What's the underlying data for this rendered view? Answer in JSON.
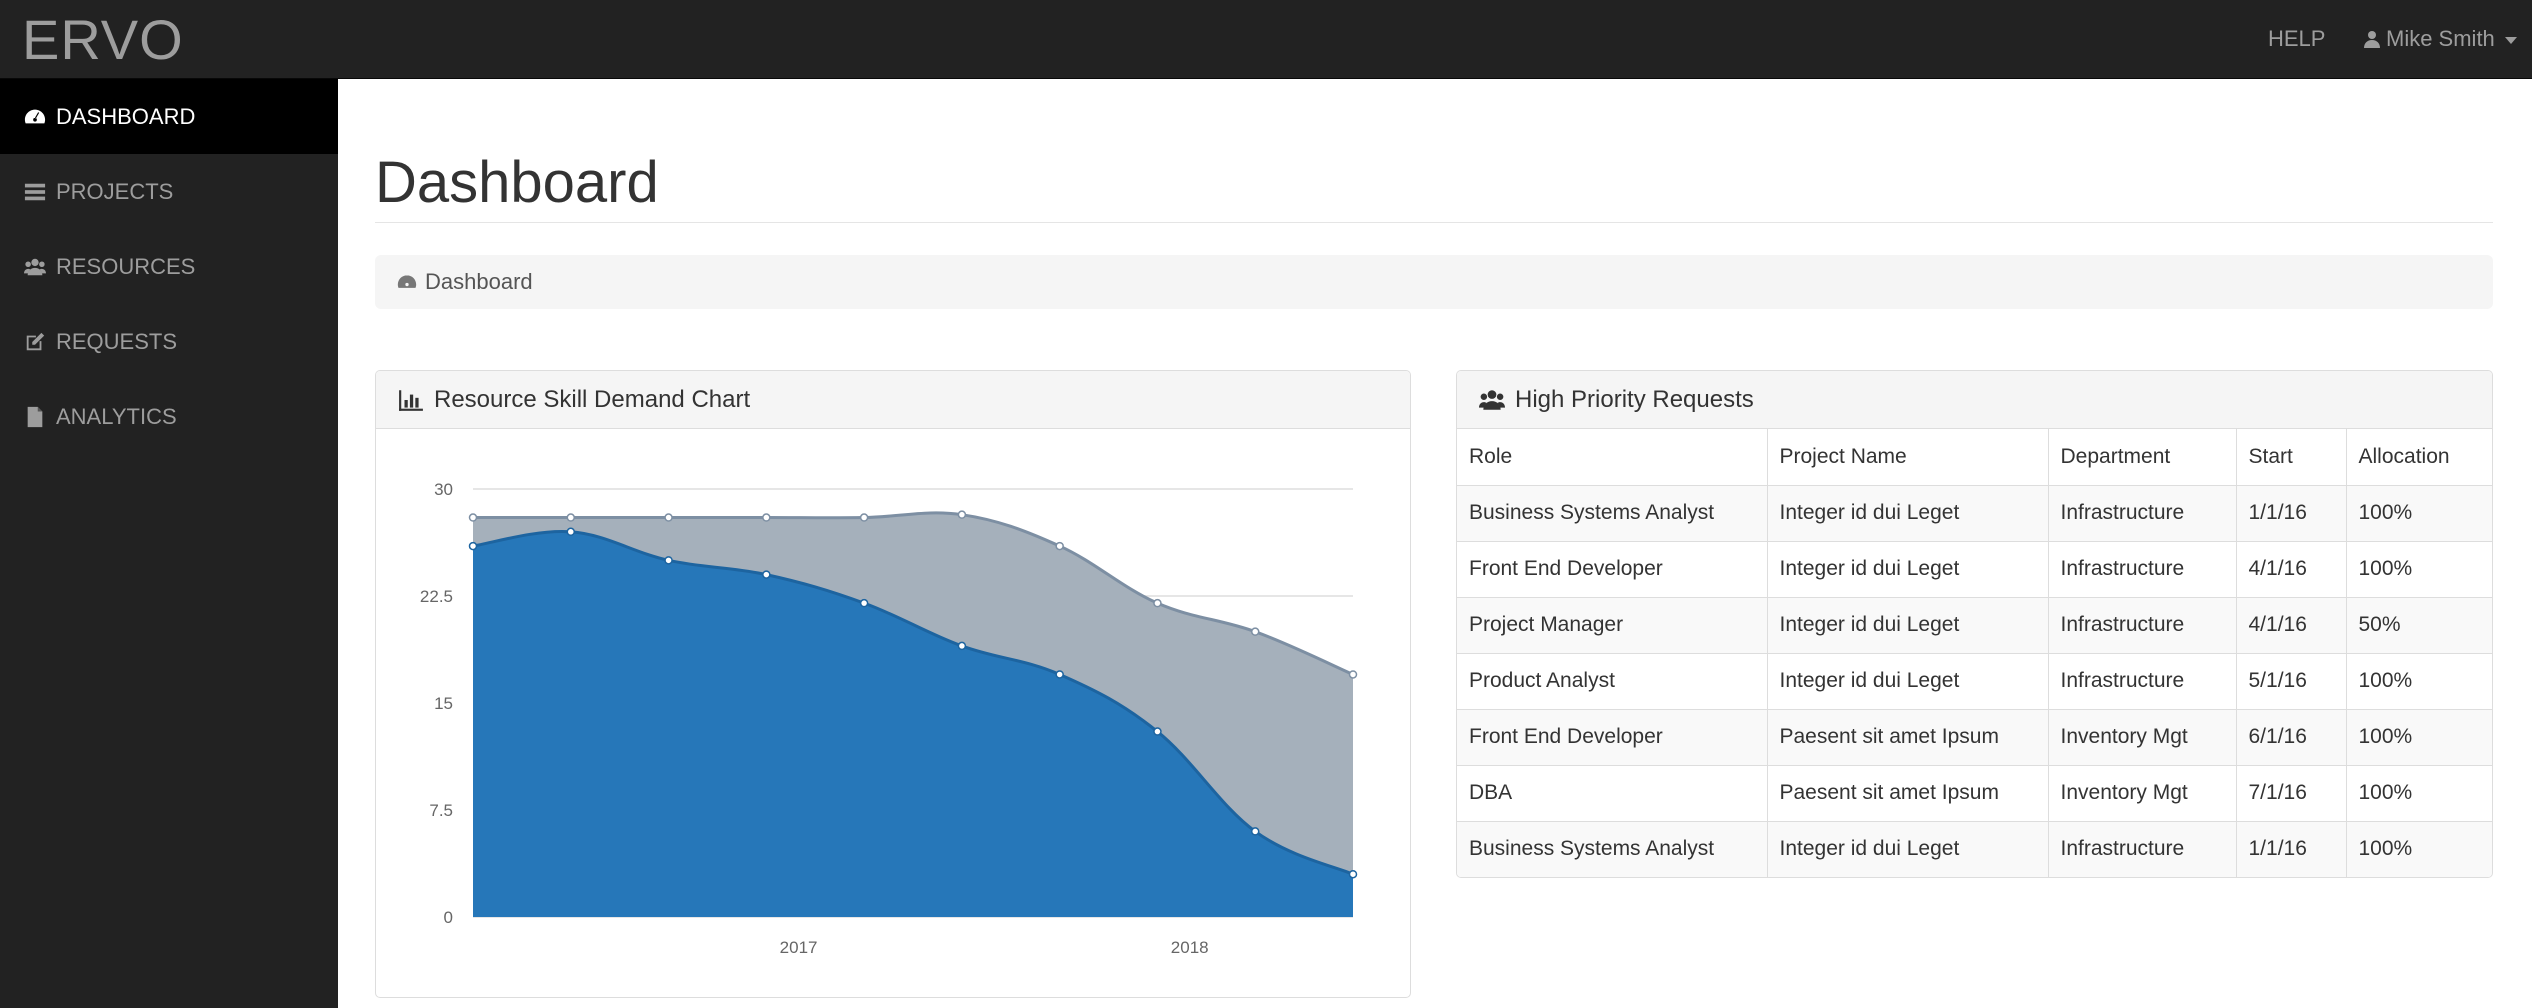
{
  "app": {
    "brand": "ERVO"
  },
  "topnav": {
    "help_label": "HELP",
    "user_name": "Mike Smith"
  },
  "sidebar": {
    "items": [
      {
        "label": "DASHBOARD",
        "icon": "dashboard-icon",
        "active": true
      },
      {
        "label": "PROJECTS",
        "icon": "tasks-icon",
        "active": false
      },
      {
        "label": "RESOURCES",
        "icon": "users-icon",
        "active": false
      },
      {
        "label": "REQUESTS",
        "icon": "edit-icon",
        "active": false
      },
      {
        "label": "ANALYTICS",
        "icon": "file-icon",
        "active": false
      }
    ]
  },
  "page": {
    "title": "Dashboard",
    "breadcrumb": "Dashboard"
  },
  "chart_panel": {
    "title": "Resource Skill Demand Chart",
    "icon": "bar-chart-icon"
  },
  "table_panel": {
    "title": "High Priority Requests",
    "icon": "users-icon",
    "columns": [
      "Role",
      "Project Name",
      "Department",
      "Start",
      "Allocation"
    ],
    "rows": [
      [
        "Business Systems Analyst",
        "Integer id dui Leget",
        "Infrastructure",
        "1/1/16",
        "100%"
      ],
      [
        "Front End Developer",
        "Integer id dui Leget",
        "Infrastructure",
        "4/1/16",
        "100%"
      ],
      [
        "Project Manager",
        "Integer id dui Leget",
        "Infrastructure",
        "4/1/16",
        "50%"
      ],
      [
        "Product Analyst",
        "Integer id dui Leget",
        "Infrastructure",
        "5/1/16",
        "100%"
      ],
      [
        "Front End Developer",
        "Paesent sit amet Ipsum",
        "Inventory Mgt",
        "6/1/16",
        "100%"
      ],
      [
        "DBA",
        "Paesent sit amet Ipsum",
        "Inventory Mgt",
        "7/1/16",
        "100%"
      ],
      [
        "Business Systems Analyst",
        "Integer id dui Leget",
        "Infrastructure",
        "1/1/16",
        "100%"
      ]
    ]
  },
  "chart_data": {
    "type": "area",
    "ylim": [
      0,
      30
    ],
    "y_ticks": [
      "0",
      "7.5",
      "15",
      "22.5",
      "30"
    ],
    "x_ticks": [
      "2017",
      "2018"
    ],
    "x_tick_index": [
      3.33,
      7.33
    ],
    "points_count": 10,
    "series": [
      {
        "values": [
          26,
          27,
          25,
          24,
          22,
          19,
          17,
          13,
          6,
          3
        ],
        "color": "#2677b9"
      },
      {
        "values": [
          28,
          28,
          28,
          28,
          28,
          28.2,
          26,
          22,
          20,
          17
        ],
        "color": "#a5b0bb"
      }
    ],
    "grid": true
  },
  "colors": {
    "navbar": "#222222",
    "sidebar_active": "#000000"
  }
}
